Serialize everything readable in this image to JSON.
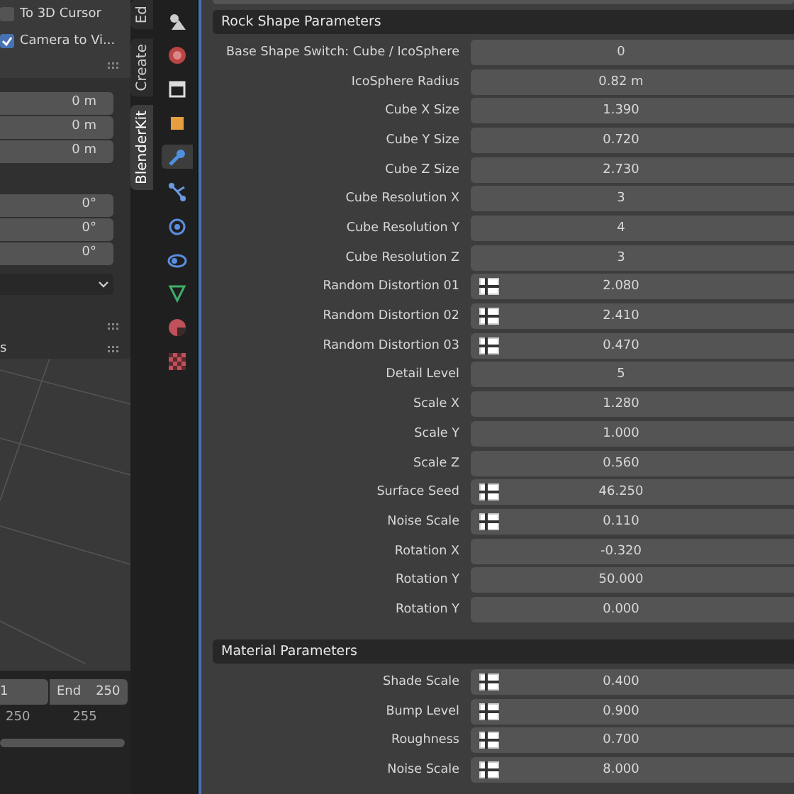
{
  "sidebar": {
    "options": [
      {
        "label": "To 3D Cursor",
        "checked": false
      },
      {
        "label": "Camera to Vi...",
        "checked": true
      }
    ],
    "location": [
      "0 m",
      "0 m",
      "0 m"
    ],
    "rotation": [
      "0°",
      "0°",
      "0°"
    ],
    "cut_label": "s"
  },
  "vertical_tabs": [
    {
      "label": "Ed",
      "selected": false
    },
    {
      "label": "Create",
      "selected": false
    },
    {
      "label": "BlenderKit",
      "selected": true
    }
  ],
  "property_tabs": [
    {
      "kind": "tool",
      "selected": false
    },
    {
      "kind": "render",
      "selected": false
    },
    {
      "kind": "output",
      "selected": false
    },
    {
      "kind": "object",
      "selected": false
    },
    {
      "kind": "modifier",
      "selected": true
    },
    {
      "kind": "particles",
      "selected": false
    },
    {
      "kind": "physics",
      "selected": false
    },
    {
      "kind": "constraints",
      "selected": false
    },
    {
      "kind": "data",
      "selected": false
    },
    {
      "kind": "material",
      "selected": false
    },
    {
      "kind": "texture",
      "selected": false
    }
  ],
  "timeline": {
    "start": "1",
    "end_label": "End",
    "end": "250",
    "ticks": [
      "250",
      "255"
    ]
  },
  "sections": [
    {
      "title": "Rock Shape Parameters",
      "rows": [
        {
          "label": "Base Shape Switch: Cube / IcoSphere",
          "value": "0",
          "kind": "plain"
        },
        {
          "label": "IcoSphere Radius",
          "value": "0.82 m",
          "kind": "plain"
        },
        {
          "label": "Cube X Size",
          "value": "1.390",
          "kind": "plain"
        },
        {
          "label": "Cube Y Size",
          "value": "0.720",
          "kind": "plain"
        },
        {
          "label": "Cube Z Size",
          "value": "2.730",
          "kind": "plain"
        },
        {
          "label": "Cube Resolution X",
          "value": "3",
          "kind": "plain"
        },
        {
          "label": "Cube Resolution Y",
          "value": "4",
          "kind": "plain"
        },
        {
          "label": "Cube Resolution Z",
          "value": "3",
          "kind": "plain"
        },
        {
          "label": "Random Distortion 01",
          "value": "2.080",
          "kind": "texture"
        },
        {
          "label": "Random Distortion 02",
          "value": "2.410",
          "kind": "texture"
        },
        {
          "label": "Random Distortion 03",
          "value": "0.470",
          "kind": "texture"
        },
        {
          "label": "Detail Level",
          "value": "5",
          "kind": "plain"
        },
        {
          "label": "Scale X",
          "value": "1.280",
          "kind": "plain"
        },
        {
          "label": "Scale Y",
          "value": "1.000",
          "kind": "plain"
        },
        {
          "label": "Scale Z",
          "value": "0.560",
          "kind": "plain"
        },
        {
          "label": "Surface Seed",
          "value": "46.250",
          "kind": "texture"
        },
        {
          "label": "Noise Scale",
          "value": "0.110",
          "kind": "texture"
        },
        {
          "label": "Rotation X",
          "value": "-0.320",
          "kind": "plain"
        },
        {
          "label": "Rotation Y",
          "value": "50.000",
          "kind": "plain"
        },
        {
          "label": "Rotation Y",
          "value": "0.000",
          "kind": "plain"
        }
      ]
    },
    {
      "title": "Material Parameters",
      "rows": [
        {
          "label": "Shade Scale",
          "value": "0.400",
          "kind": "texture"
        },
        {
          "label": "Bump Level",
          "value": "0.900",
          "kind": "texture"
        },
        {
          "label": "Roughness",
          "value": "0.700",
          "kind": "texture"
        },
        {
          "label": "Noise Scale",
          "value": "8.000",
          "kind": "texture"
        }
      ]
    }
  ]
}
